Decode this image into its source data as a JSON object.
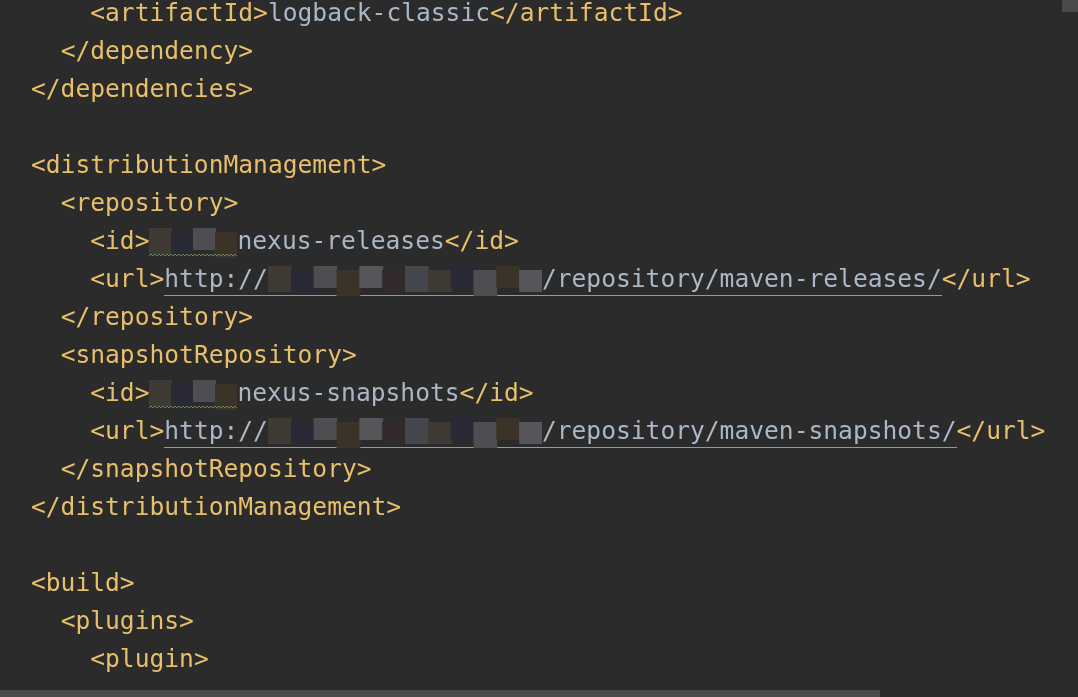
{
  "editor": {
    "lines": [
      {
        "segments": [
          {
            "kind": "tag",
            "text": "    <artifactId>"
          },
          {
            "kind": "text",
            "text": "logback-classic"
          },
          {
            "kind": "tag",
            "text": "</artifactId>"
          }
        ]
      },
      {
        "segments": [
          {
            "kind": "tag",
            "text": "  </dependency>"
          }
        ]
      },
      {
        "segments": [
          {
            "kind": "tag",
            "text": "</dependencies>"
          }
        ]
      },
      {
        "blank_line_before": true,
        "segments": [
          {
            "kind": "tag",
            "text": "<distributionManagement>"
          }
        ]
      },
      {
        "segments": [
          {
            "kind": "tag",
            "text": "  <repository>"
          }
        ]
      },
      {
        "segments": [
          {
            "kind": "tag",
            "text": "    <id>"
          },
          {
            "kind": "mask",
            "warning": true
          },
          {
            "kind": "text",
            "text": "nexus-releases"
          },
          {
            "kind": "tag",
            "text": "</id>"
          }
        ]
      },
      {
        "segments": [
          {
            "kind": "tag",
            "text": "    <url>"
          },
          {
            "kind": "url",
            "prefix": "http://",
            "suffix": "/repository/maven-releases/"
          },
          {
            "kind": "tag",
            "text": "</url>"
          }
        ]
      },
      {
        "segments": [
          {
            "kind": "tag",
            "text": "  </repository>"
          }
        ]
      },
      {
        "segments": [
          {
            "kind": "tag",
            "text": "  <snapshotRepository>"
          }
        ]
      },
      {
        "segments": [
          {
            "kind": "tag",
            "text": "    <id>"
          },
          {
            "kind": "mask",
            "warning": true
          },
          {
            "kind": "text",
            "text": "nexus-snapshots"
          },
          {
            "kind": "tag",
            "text": "</id>"
          }
        ]
      },
      {
        "segments": [
          {
            "kind": "tag",
            "text": "    <url>"
          },
          {
            "kind": "url",
            "prefix": "http://",
            "suffix": "/repository/maven-snapshots/"
          },
          {
            "kind": "tag",
            "text": "</url>"
          }
        ]
      },
      {
        "segments": [
          {
            "kind": "tag",
            "text": "  </snapshotRepository>"
          }
        ]
      },
      {
        "segments": [
          {
            "kind": "tag",
            "text": "</distributionManagement>"
          }
        ]
      },
      {
        "blank_line_before": true,
        "segments": [
          {
            "kind": "tag",
            "text": "<build>"
          }
        ]
      },
      {
        "segments": [
          {
            "kind": "tag",
            "text": "  <plugins>"
          }
        ]
      },
      {
        "segments": [
          {
            "kind": "tag",
            "text": "    <plugin>"
          }
        ]
      }
    ]
  }
}
